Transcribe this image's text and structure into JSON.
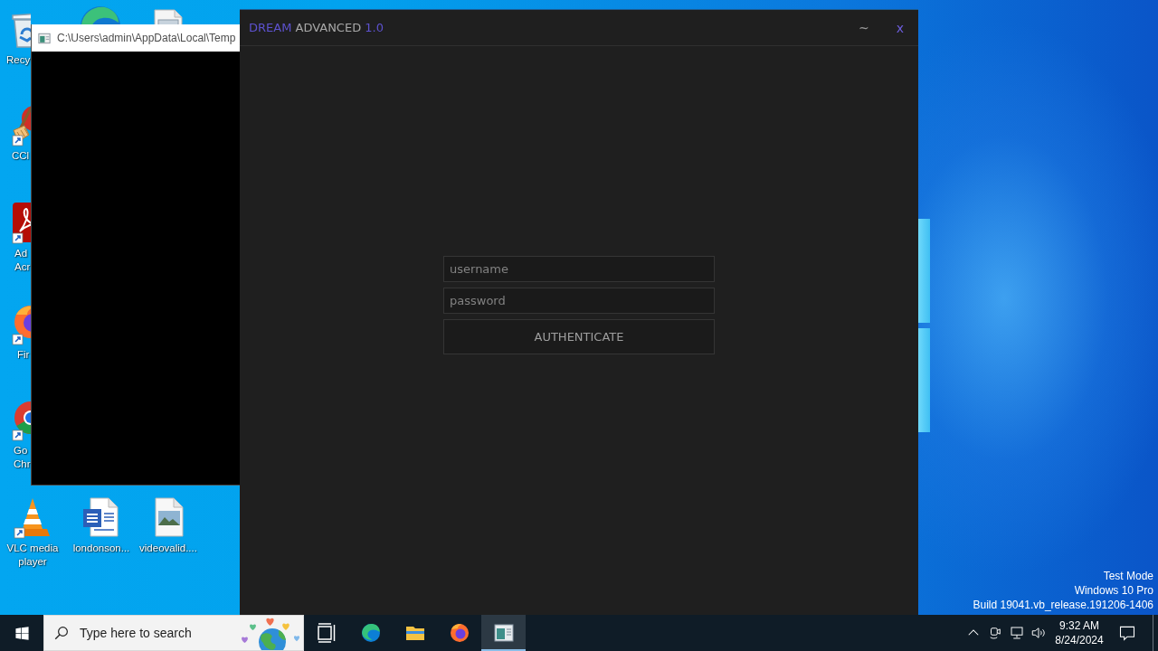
{
  "desktop": {
    "icons": [
      {
        "kind": "recycle-bin",
        "label": "Recy"
      },
      {
        "kind": "edge"
      },
      {
        "kind": "document"
      },
      {
        "kind": "cleaner",
        "label": "CCl"
      },
      {
        "kind": "pdf",
        "label": "Ad Acr"
      },
      {
        "kind": "firefox",
        "label": "Fir"
      },
      {
        "kind": "chrome",
        "label": "Go Chr"
      },
      {
        "kind": "vlc",
        "label": "VLC media player"
      },
      {
        "kind": "word",
        "label": "londonson..."
      },
      {
        "kind": "image",
        "label": "videovalid...."
      }
    ],
    "system_info": [
      "Test Mode",
      "Windows 10 Pro",
      "Build 19041.vb_release.191206-1406"
    ]
  },
  "console_window": {
    "title": "C:\\Users\\admin\\AppData\\Local\\Temp"
  },
  "app_window": {
    "title_parts": [
      {
        "text": "DREAM",
        "kind": "accent"
      },
      {
        "text": "ADVANCED",
        "kind": "plain"
      },
      {
        "text": "1.0",
        "kind": "accent"
      }
    ],
    "controls": [
      {
        "label": "~",
        "kind": "minimize"
      },
      {
        "label": "x",
        "kind": "close"
      }
    ],
    "fields": [
      {
        "placeholder": "username"
      },
      {
        "placeholder": "password"
      }
    ],
    "submit": {
      "label": "AUTHENTICATE"
    }
  },
  "taskbar": {
    "search": {
      "placeholder": "Type here to search"
    },
    "apps": [
      {
        "kind": "task-view",
        "selected": false
      },
      {
        "kind": "edge",
        "selected": false
      },
      {
        "kind": "explorer",
        "selected": false
      },
      {
        "kind": "firefox",
        "selected": false
      },
      {
        "kind": "app-window",
        "selected": true
      }
    ],
    "tray": {
      "time": "9:32 AM",
      "date": "8/24/2024"
    }
  }
}
